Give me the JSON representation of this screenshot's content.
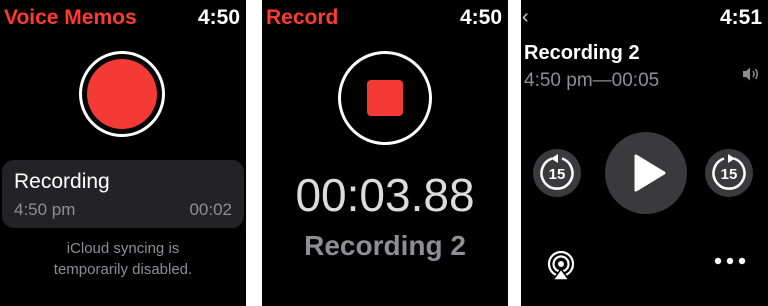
{
  "screen1": {
    "title": "Voice Memos",
    "time": "4:50",
    "recording": {
      "name": "Recording",
      "time": "4:50 pm",
      "duration": "00:02"
    },
    "sync_line1": "iCloud syncing is",
    "sync_line2": "temporarily disabled."
  },
  "screen2": {
    "title": "Record",
    "time": "4:50",
    "timer": "00:03.88",
    "recording_name": "Recording 2"
  },
  "screen3": {
    "back": "‹",
    "time": "4:51",
    "title": "Recording 2",
    "subtitle": "4:50 pm—00:05",
    "skip_back_seconds": "15",
    "skip_forward_seconds": "15"
  },
  "colors": {
    "accent": "#f33a34",
    "title_red": "#ff3b30",
    "secondary": "#8e8e93",
    "card": "#232326"
  },
  "icons": [
    "record-icon",
    "stop-icon",
    "back-chevron-icon",
    "speaker-icon",
    "skip-back-15-icon",
    "play-icon",
    "skip-forward-15-icon",
    "airplay-icon",
    "more-icon"
  ]
}
